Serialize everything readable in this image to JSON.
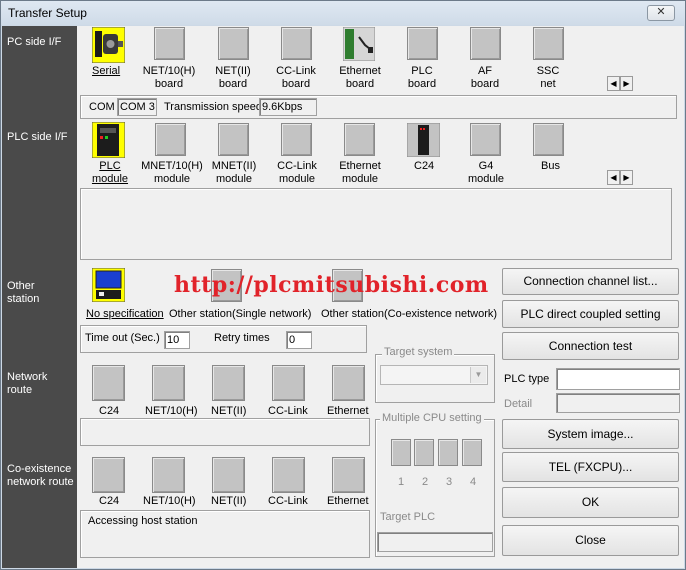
{
  "window": {
    "title": "Transfer Setup",
    "close_glyph": "✕"
  },
  "watermark": "http://plcmitsubishi.com",
  "sections": {
    "pc_side": "PC side I/F",
    "plc_side": "PLC side I/F",
    "other_station": "Other station",
    "network_route": "Network route",
    "coexistence_route": "Co-existence network route"
  },
  "pc_side": {
    "items": [
      {
        "label": "Serial",
        "icon": "serial-port-icon"
      },
      {
        "label": "NET/10(H) board",
        "icon": "board-icon"
      },
      {
        "label": "NET(II) board",
        "icon": "board-icon"
      },
      {
        "label": "CC-Link board",
        "icon": "board-icon"
      },
      {
        "label": "Ethernet board",
        "icon": "ethernet-board-icon"
      },
      {
        "label": "PLC board",
        "icon": "board-icon"
      },
      {
        "label": "AF board",
        "icon": "board-icon"
      },
      {
        "label": "SSC net",
        "icon": "board-icon"
      }
    ],
    "com_label": "COM",
    "com_value": "COM 3",
    "speed_label": "Transmission speed",
    "speed_value": "9.6Kbps"
  },
  "plc_side": {
    "items": [
      {
        "label": "PLC module",
        "icon": "plc-module-icon"
      },
      {
        "label": "MNET/10(H) module",
        "icon": "module-icon"
      },
      {
        "label": "MNET(II) module",
        "icon": "module-icon"
      },
      {
        "label": "CC-Link module",
        "icon": "module-icon"
      },
      {
        "label": "Ethernet module",
        "icon": "module-icon"
      },
      {
        "label": "C24",
        "icon": "c24-module-icon"
      },
      {
        "label": "G4 module",
        "icon": "module-icon"
      },
      {
        "label": "Bus",
        "icon": "module-icon"
      }
    ]
  },
  "other_station": {
    "items": [
      {
        "label": "No specification",
        "icon": "no-spec-icon"
      },
      {
        "label": "Other station(Single network)",
        "icon": "station-icon"
      },
      {
        "label": "Other station(Co-existence network)",
        "icon": "station-icon"
      }
    ],
    "timeout_label": "Time out (Sec.)",
    "timeout_value": "10",
    "retry_label": "Retry times",
    "retry_value": "0"
  },
  "network_route": {
    "items": [
      "C24",
      "NET/10(H)",
      "NET(II)",
      "CC-Link",
      "Ethernet"
    ]
  },
  "coexistence_route": {
    "items": [
      "C24",
      "NET/10(H)",
      "NET(II)",
      "CC-Link",
      "Ethernet"
    ],
    "status": "Accessing host station"
  },
  "target_system": {
    "title": "Target system"
  },
  "multiple_cpu": {
    "title": "Multiple CPU setting",
    "numbers": [
      "1",
      "2",
      "3",
      "4"
    ],
    "target_plc_label": "Target PLC"
  },
  "plc_type": {
    "label": "PLC type",
    "detail_label": "Detail"
  },
  "buttons": {
    "connection_channel_list": "Connection  channel  list...",
    "plc_direct": "PLC direct coupled setting",
    "connection_test": "Connection test",
    "system_image": "System   image...",
    "tel": "TEL (FXCPU)...",
    "ok": "OK",
    "close": "Close"
  }
}
